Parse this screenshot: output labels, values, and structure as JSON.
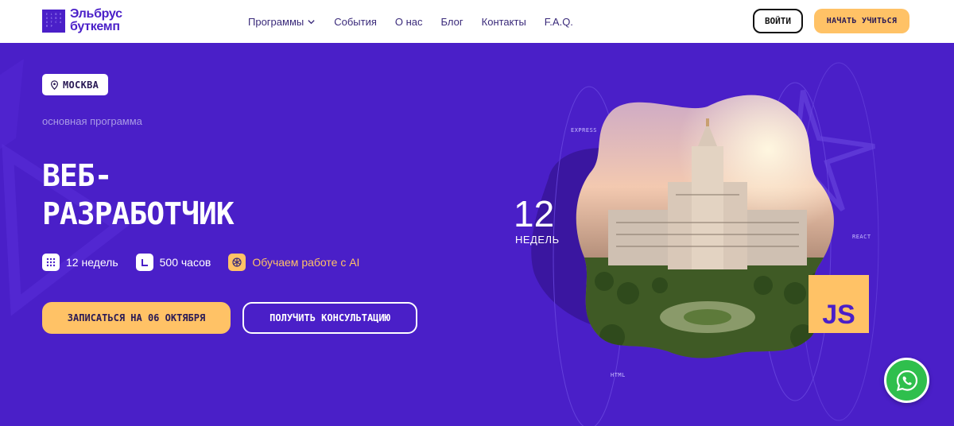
{
  "header": {
    "logo_line1": "Эльбрус",
    "logo_line2": "буткемп",
    "logo_mark": [
      "E",
      "L",
      "B",
      "R",
      "U",
      "S",
      "B",
      "O",
      "O",
      "T",
      "C",
      "A",
      "M",
      "P",
      "",
      ""
    ],
    "nav": [
      {
        "label": "Программы",
        "has_dropdown": true
      },
      {
        "label": "События"
      },
      {
        "label": "О нас"
      },
      {
        "label": "Блог"
      },
      {
        "label": "Контакты"
      },
      {
        "label": "F.A.Q."
      }
    ],
    "login_label": "ВОЙТИ",
    "start_label": "НАЧАТЬ УЧИТЬСЯ"
  },
  "hero": {
    "city": "МОСКВА",
    "subtitle": "основная программа",
    "title_line1": "ВЕБ-",
    "title_line2": "РАЗРАБОТЧИК",
    "features": [
      {
        "icon": "calendar-grid-icon",
        "label": "12 недель"
      },
      {
        "icon": "clock-icon",
        "label": "500 часов"
      },
      {
        "icon": "ai-openai-icon",
        "label": "Обучаем работе с AI"
      }
    ],
    "cta_primary": "ЗАПИСАТЬСЯ НА 06 ОКТЯБРЯ",
    "cta_secondary": "ПОЛУЧИТЬ КОНСУЛЬТАЦИЮ",
    "weeks_number": "12",
    "weeks_label": "НЕДЕЛЬ",
    "tech_labels": {
      "express": "EXPRESS",
      "react": "REACT",
      "html": "HTML"
    },
    "js_badge": "JS"
  },
  "colors": {
    "brand_purple": "#4a1fc8",
    "accent_yellow": "#ffc266",
    "whatsapp_green": "#2fbf4d"
  }
}
